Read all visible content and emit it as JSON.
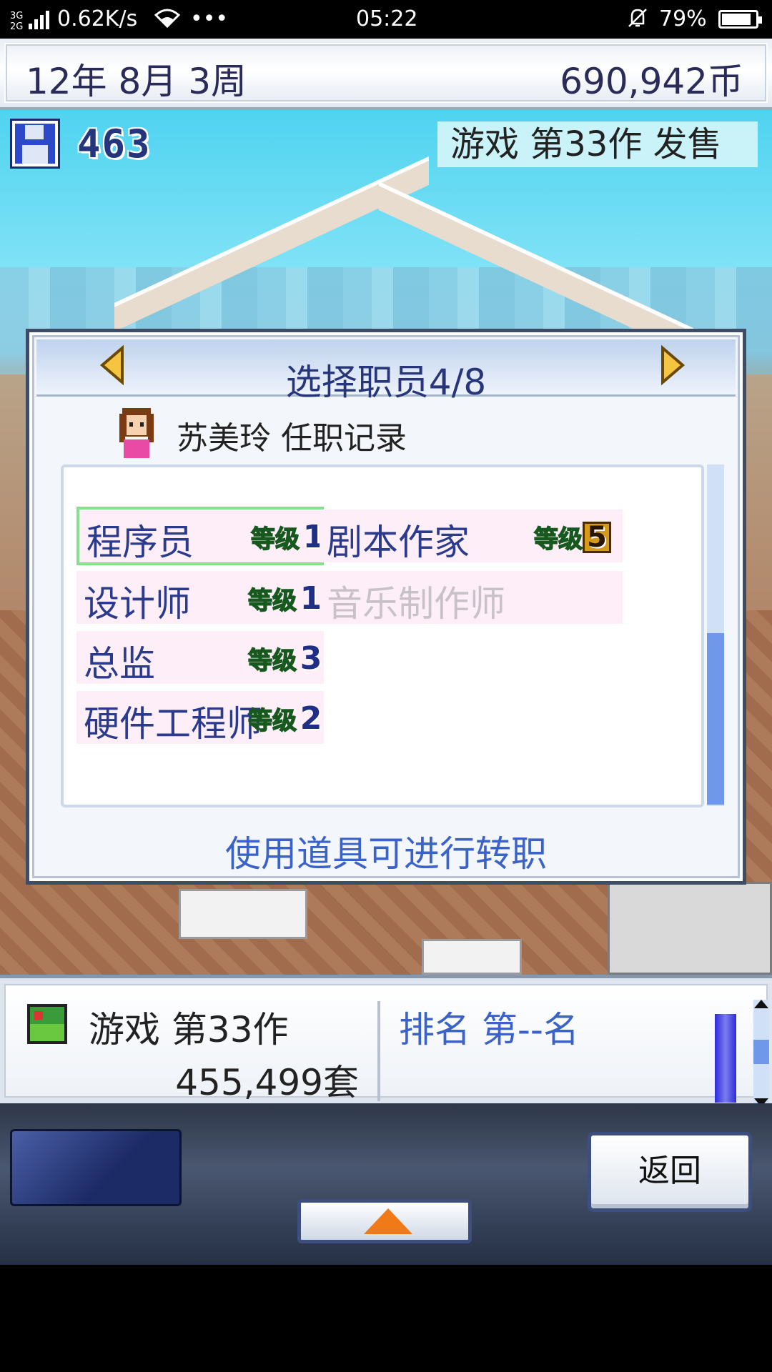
{
  "status_bar": {
    "network": "3G 2G",
    "speed": "0.62K/s",
    "more": "•••",
    "time": "05:22",
    "battery": "79%",
    "battery_level": 0.79
  },
  "top_bar": {
    "date": "12年 8月 3周",
    "money": "690,942币"
  },
  "scene": {
    "save_count": "463",
    "release_banner": "游戏 第33作 发售"
  },
  "dialog": {
    "title": "选择职员4/8",
    "employee_record": "苏美玲 任职记录",
    "level_label": "等级",
    "jobs": [
      {
        "name": "程序员",
        "level": "1"
      },
      {
        "name": "剧本作家",
        "level": "5"
      },
      {
        "name": "设计师",
        "level": "1"
      },
      {
        "name": "音乐制作师",
        "level": ""
      },
      {
        "name": "总监",
        "level": "3"
      },
      {
        "name": "硬件工程师",
        "level": "2"
      }
    ],
    "footer": "使用道具可进行转职"
  },
  "bottom_panel": {
    "game_name": "游戏 第33作",
    "sales": "455,499套",
    "rank": "排名 第--名"
  },
  "nav": {
    "back_label": "返回"
  },
  "colors": {
    "accent_blue": "#3a62c8",
    "job_text": "#2a3a8c",
    "selected_border": "#86e08f",
    "level_green": "#3fa33f"
  }
}
